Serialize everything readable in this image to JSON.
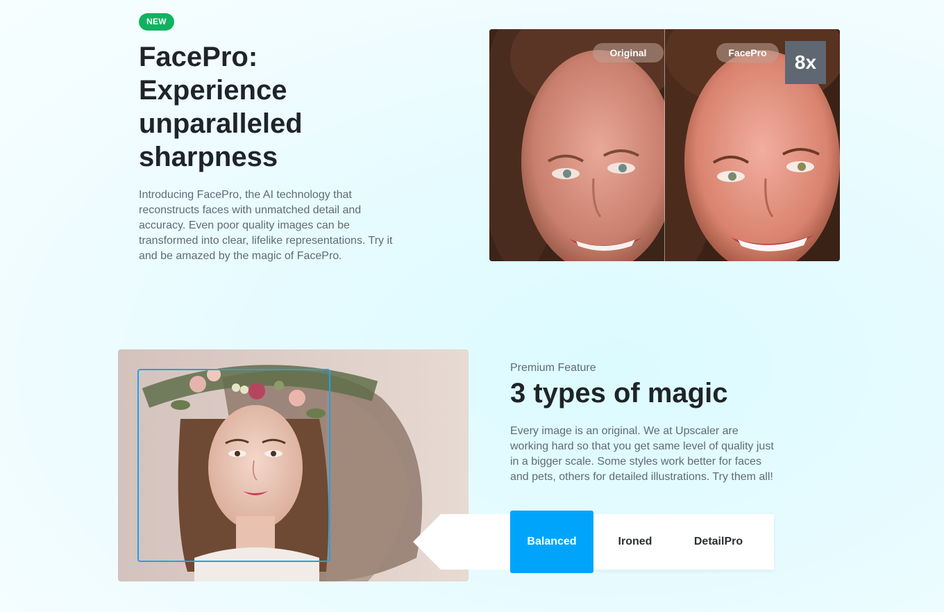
{
  "hero": {
    "badge": "NEW",
    "title": "FacePro: Experience unparalleled sharpness",
    "description": "Introducing FacePro, the AI technology that reconstructs faces with unmatched detail and accuracy. Even poor quality images can be transformed into clear, lifelike representations. Try it and be amazed by the magic of FacePro.",
    "compare": {
      "left_label": "Original",
      "right_label": "FacePro",
      "zoom": "8x"
    }
  },
  "magic": {
    "eyebrow": "Premium Feature",
    "title": "3 types of magic",
    "description": "Every image is an original. We at Upscaler are working hard so that you get same level of quality just in a bigger scale. Some styles work better for faces and pets, others for detailed illustrations. Try them all!",
    "modes": [
      {
        "label": "Balanced",
        "active": true
      },
      {
        "label": "Ironed",
        "active": false
      },
      {
        "label": "DetailPro",
        "active": false
      }
    ]
  },
  "colors": {
    "badge_green": "#10b261",
    "accent_blue": "#00a5fb",
    "zoom_badge": "#5f6772"
  }
}
